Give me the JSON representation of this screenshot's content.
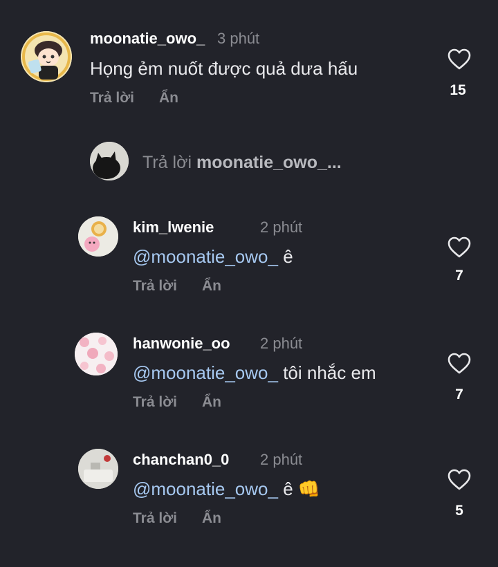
{
  "colors": {
    "background": "#22232a",
    "username": "#ffffff",
    "muted_text": "#8b8c92",
    "mention": "#a6c8f0",
    "heart_outline": "#e8e8ea"
  },
  "main_comment": {
    "username": "moonatie_owo_",
    "time": "3 phút",
    "text": "Họng ẻm nuốt được quả dưa hấu",
    "reply_label": "Trả lời",
    "hide_label": "Ẩn",
    "likes": "15",
    "avatar_icon": "avatar-cartoon-boy"
  },
  "reply_box": {
    "prefix": "Trả lời",
    "target": "moonatie_owo_..."
  },
  "replies": [
    {
      "username": "kim_lwenie",
      "time": "2 phút",
      "mention": "@moonatie_owo_",
      "text": " ê",
      "emoji": "",
      "reply_label": "Trả lời",
      "hide_label": "Ẩn",
      "likes": "7"
    },
    {
      "username": "hanwonie_oo",
      "time": "2 phút",
      "mention": "@moonatie_owo_",
      "text": " tôi nhắc em",
      "emoji": "",
      "reply_label": "Trả lời",
      "hide_label": "Ẩn",
      "likes": "7"
    },
    {
      "username": "chanchan0_0",
      "time": "2 phút",
      "mention": "@moonatie_owo_",
      "text": " ê ",
      "emoji": "👊",
      "reply_label": "Trả lời",
      "hide_label": "Ẩn",
      "likes": "5"
    }
  ]
}
